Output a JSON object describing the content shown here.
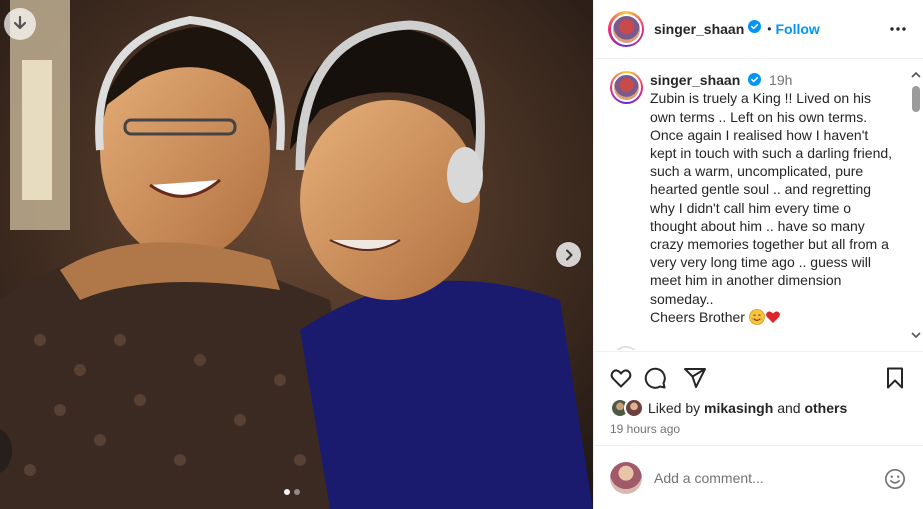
{
  "post": {
    "username": "singer_shaan",
    "follow_label": "Follow",
    "separator": "•",
    "caption": {
      "username": "singer_shaan",
      "time": "19h",
      "text": "Zubin is truely a King !! Lived on his own terms .. Left on his own terms. Once again I realised how I haven't kept in touch with such a darling friend, such a warm, uncomplicated, pure hearted gentle soul .. and regretting why I didn't call him every time o thought about him .. have so many crazy memories together but all from  a very very long time ago .. guess will meet him in another dimension someday..\nCheers Brother",
      "emojis": [
        "smiling-face-emoji",
        "red-heart-emoji"
      ]
    },
    "likes": {
      "prefix": "Liked by",
      "user": "mikasingh",
      "connector": "and",
      "others": "others"
    },
    "timestamp": "19 hours ago",
    "comment_placeholder": "Add a comment...",
    "carousel": {
      "slides": 2,
      "current": 1
    }
  },
  "icons": {
    "verified": "verified-badge-icon",
    "more": "more-options-icon",
    "like": "heart-icon",
    "comment": "comment-icon",
    "share": "share-icon",
    "save": "bookmark-icon",
    "emoji": "emoji-icon",
    "download": "download-icon",
    "next": "chevron-right-icon"
  },
  "colors": {
    "link_blue": "#0095f6",
    "verified_blue": "#0095f6",
    "muted": "#737373",
    "text": "#262626"
  }
}
